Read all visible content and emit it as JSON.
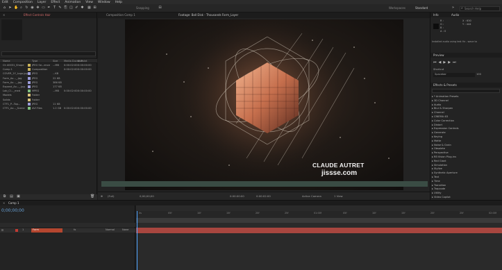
{
  "menu": [
    "Edit",
    "Composition",
    "Layer",
    "Effect",
    "Animation",
    "View",
    "Window",
    "Help"
  ],
  "toolbar": {
    "snapping_label": "Snapping",
    "workspace_label": "Workspaces",
    "workspace_value": "Standard",
    "search_placeholder": "Search Help"
  },
  "project_panel": {
    "tabs": [
      "Effect Controls Hair"
    ],
    "columns": [
      "Name",
      "Type",
      "Size",
      "Media Duration",
      "In Point"
    ],
    "rows": [
      {
        "name": "Ch 40031_Shape",
        "type": "JPEG Se...ence",
        "size": "...MB",
        "dur": "0:00:02:00",
        "in": "0:00:00:00",
        "color": "#c9b25a"
      },
      {
        "name": "Comp 1",
        "type": "Composition",
        "size": "",
        "dur": "0:00:02:00",
        "in": "0:00:00:00",
        "color": "#c9b25a"
      },
      {
        "name": "COVER_1Y_Logo.jpg",
        "type": "JPEG",
        "size": "...KB",
        "dur": "",
        "in": "",
        "color": "#9b9bd8"
      },
      {
        "name": "Form_Ax..._.jpg",
        "type": "JPEG",
        "size": "22 KB",
        "dur": "",
        "in": "",
        "color": "#9b9bd8"
      },
      {
        "name": "Form_Ax..._.jpg",
        "type": "JPEG",
        "size": "386 KB",
        "dur": "",
        "in": "",
        "color": "#9b9bd8"
      },
      {
        "name": "Expand_Ax..._.jpg",
        "type": "JPEG",
        "size": "177 KB",
        "dur": "",
        "in": "",
        "color": "#9b9bd8"
      },
      {
        "name": "Lab_Cl..._med",
        "type": "MPEG",
        "size": "...MB",
        "dur": "0:00:02:00",
        "in": "0:00:00:00",
        "color": "#7fbf7f"
      },
      {
        "name": "Models",
        "type": "Folder",
        "size": "",
        "dur": "",
        "in": "",
        "color": "#d9c27a"
      },
      {
        "name": "Solids",
        "type": "Folder",
        "size": "",
        "dur": "",
        "in": "",
        "color": "#d9c27a"
      },
      {
        "name": "CTF1_P...Top...",
        "type": "JPEG",
        "size": "11 KB",
        "dur": "",
        "in": "",
        "color": "#9b9bd8"
      },
      {
        "name": "CTF1_Ax..._Scene",
        "type": "AVI Files",
        "size": "1.2 GB",
        "dur": "0:00:02:00",
        "in": "0:00:00:00",
        "color": "#7fbf7f"
      }
    ]
  },
  "viewer": {
    "tabs": [
      "Composition Comp 1",
      "Footage: Ball Disk - Thousands Form_Layer"
    ],
    "credit_name": "CLAUDE AUTRET",
    "credit_url": "jissse.com",
    "controls": {
      "zoom": "(Full)",
      "timecode": "0;00;00;00",
      "camera": "Active Camera",
      "views": "1 View",
      "current": "0:00:00:00",
      "end": "0:00:02:00"
    }
  },
  "right_panels": {
    "info": {
      "title": "Info",
      "audio_tab": "Audio",
      "lines": [
        "R :",
        "G :",
        "B :",
        "A : 0"
      ],
      "coords": [
        "X : 630",
        "Y : 444"
      ],
      "footer": "Installed audio using test Hz - wave to"
    },
    "preview": {
      "title": "Preview",
      "shortcut_label": "Shortcut",
      "shortcut_value": "Spacebar",
      "pct": "100"
    },
    "effects": {
      "title": "Effects & Presets",
      "search_placeholder": "",
      "items": [
        "* Animation Presets",
        "3D Channel",
        "Audio",
        "Blur & Sharpen",
        "Channel",
        "CINEMA 4D",
        "Color Correction",
        "Distort",
        "Expression Controls",
        "Generate",
        "Keying",
        "Matte",
        "Noise & Grain",
        "Obsolete",
        "Perspective",
        "RE:Vision Plug-ins",
        "Red Giant",
        "Simulation",
        "Stylize",
        "Synthetic Aperture",
        "Text",
        "Time",
        "Transition",
        "Trapcode",
        "Utility",
        "Video Copilot"
      ]
    }
  },
  "timeline": {
    "tabs": [
      "Comp 1"
    ],
    "timecode": "0;00;00;00",
    "layer": {
      "num": "1",
      "name": "Form",
      "mode": "Normal",
      "parent": "None"
    },
    "ticks": [
      "0s",
      "05f",
      "10f",
      "15f",
      "20f",
      "25f",
      "01:00f",
      "05f",
      "10f",
      "15f",
      "20f",
      "25f",
      "02:00f"
    ]
  },
  "colors": {
    "accent": "#4da3ff",
    "layer_bar": "#a8463f",
    "work_area": "#3a3a3a",
    "background": "#1d1d1d"
  }
}
